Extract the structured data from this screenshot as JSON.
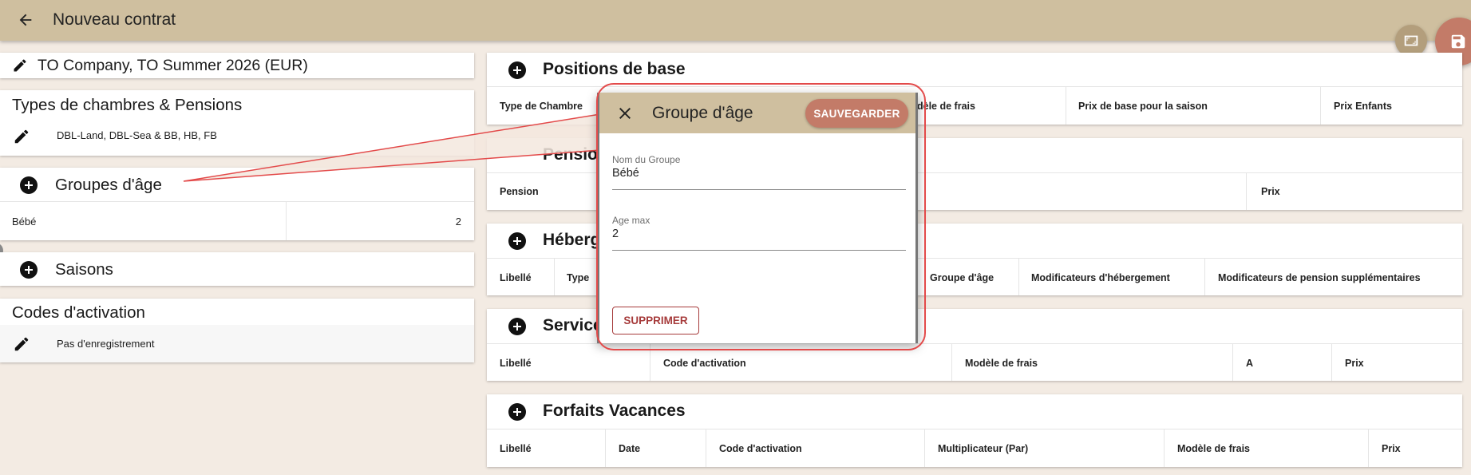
{
  "header": {
    "title": "Nouveau contrat"
  },
  "contract_card": {
    "title": "TO Company, TO Summer 2026 (EUR)"
  },
  "room_types_card": {
    "title": "Types de chambres & Pensions",
    "value": "DBL-Land, DBL-Sea & BB, HB, FB"
  },
  "age_groups_card": {
    "title": "Groupes d'âge",
    "rows": [
      {
        "name": "Bébé",
        "max_age": "2"
      }
    ]
  },
  "seasons_card": {
    "title": "Saisons"
  },
  "activation_codes_card": {
    "title": "Codes d'activation",
    "value": "Pas d'enregistrement"
  },
  "base_positions": {
    "title": "Positions de base",
    "columns": [
      "Type de Chambre",
      "dèle de frais",
      "Prix de base pour la saison",
      "Prix Enfants"
    ]
  },
  "pensions": {
    "title": "Pensio",
    "columns": [
      "Pension",
      "Prix"
    ]
  },
  "accommodation": {
    "title": "Héberg",
    "columns": [
      "Libellé",
      "Type",
      "Groupe d'âge",
      "Modificateurs d'hébergement",
      "Modificateurs de pension supplémentaires"
    ]
  },
  "services": {
    "title": "Service",
    "columns": [
      "Libellé",
      "Code d'activation",
      "Modèle de frais",
      "A",
      "Prix"
    ]
  },
  "packages": {
    "title": "Forfaits Vacances",
    "columns": [
      "Libellé",
      "Date",
      "Code d'activation",
      "Multiplicateur (Par)",
      "Modèle de frais",
      "Prix"
    ]
  },
  "dialog": {
    "title": "Groupe d'âge",
    "save_label": "SAUVEGARDER",
    "delete_label": "SUPPRIMER",
    "group_name_label": "Nom du Groupe",
    "group_name_value": "Bébé",
    "max_age_label": "Age max",
    "max_age_value": "2"
  },
  "colors": {
    "topbar": "#cfbf9f",
    "background": "#f3ebe3",
    "accent": "#c37b68",
    "callout": "#e34a4a"
  },
  "icons": [
    "arrow-back-icon",
    "fullscreen-icon",
    "save-icon",
    "edit-icon",
    "add-circle-icon",
    "close-icon"
  ]
}
